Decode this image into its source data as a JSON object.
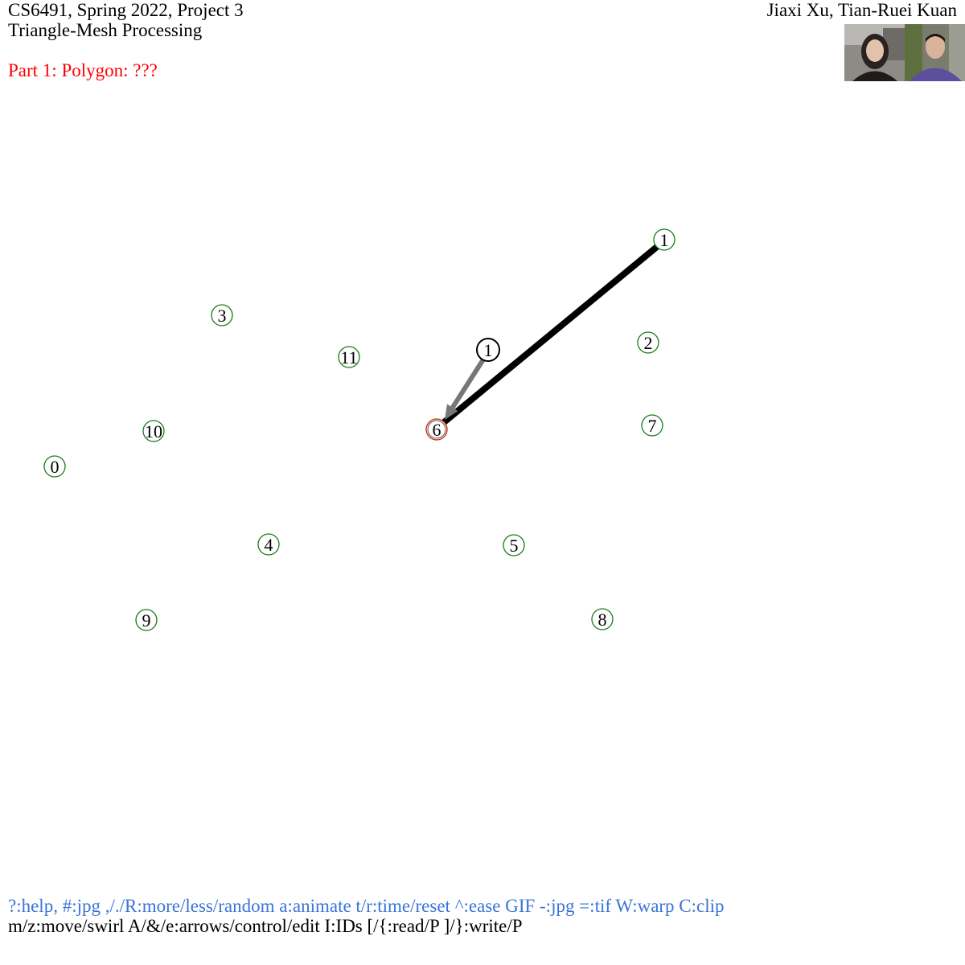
{
  "header": {
    "course": "CS6491, Spring 2022, Project 3",
    "subtitle": "Triangle-Mesh Processing",
    "authors": "Jiaxi Xu, Tian-Ruei Kuan",
    "part": "Part 1: Polygon: ???"
  },
  "colors": {
    "part_title": "#ff0000",
    "help_line_1": "#3b74d9",
    "help_line_2": "#000000",
    "vertex_ring": "#1a7a1a",
    "selected_ring": "#cc2200",
    "edge": "#000000",
    "arrow": "#777777"
  },
  "vertices": [
    {
      "id": "0",
      "label": "0"
    },
    {
      "id": "1",
      "label": "1"
    },
    {
      "id": "2",
      "label": "2"
    },
    {
      "id": "3",
      "label": "3"
    },
    {
      "id": "4",
      "label": "4"
    },
    {
      "id": "5",
      "label": "5"
    },
    {
      "id": "6",
      "label": "6",
      "selected": true
    },
    {
      "id": "7",
      "label": "7"
    },
    {
      "id": "8",
      "label": "8"
    },
    {
      "id": "9",
      "label": "9"
    },
    {
      "id": "10",
      "label": "10"
    },
    {
      "id": "11",
      "label": "11"
    }
  ],
  "cursor_label": "1",
  "help": {
    "line1": "?:help, #:jpg ,/./R:more/less/random a:animate t/r:time/reset ^:ease GIF -:jpg =:tif W:warp C:clip",
    "line2": "m/z:move/swirl A/&/e:arrows/control/edit I:IDs [/{:read/P ]/}:write/P"
  },
  "video_feed": {
    "participants": 2
  }
}
